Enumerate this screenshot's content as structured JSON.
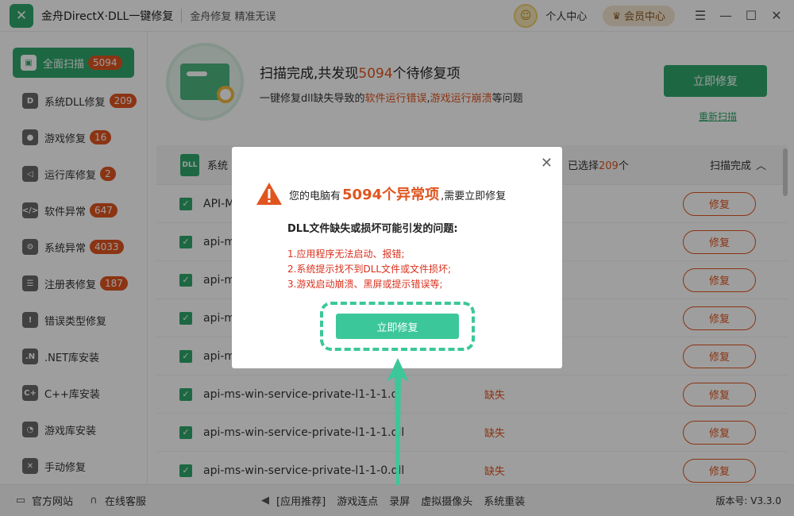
{
  "titlebar": {
    "app_title": "金舟DirectX·DLL一键修复",
    "slogan": "金舟修复 精准无误",
    "user_center": "个人中心",
    "vip_center": "会员中心"
  },
  "sidebar": {
    "items": [
      {
        "label": "全面扫描",
        "badge": "5094",
        "icon": "scan-icon"
      },
      {
        "label": "系统DLL修复",
        "badge": "209",
        "icon": "dll-icon"
      },
      {
        "label": "游戏修复",
        "badge": "16",
        "icon": "gamepad-icon"
      },
      {
        "label": "运行库修复",
        "badge": "2",
        "icon": "runtime-icon"
      },
      {
        "label": "软件异常",
        "badge": "647",
        "icon": "software-icon"
      },
      {
        "label": "系统异常",
        "badge": "4033",
        "icon": "gear-icon"
      },
      {
        "label": "注册表修复",
        "badge": "187",
        "icon": "registry-icon"
      },
      {
        "label": "错误类型修复",
        "badge": "",
        "icon": "warning-icon"
      },
      {
        "label": ".NET库安装",
        "badge": "",
        "icon": "dotnet-icon"
      },
      {
        "label": "C++库安装",
        "badge": "",
        "icon": "cpp-icon"
      },
      {
        "label": "游戏库安装",
        "badge": "",
        "icon": "pacman-icon"
      },
      {
        "label": "手动修复",
        "badge": "",
        "icon": "wrench-icon"
      }
    ]
  },
  "scan": {
    "title_prefix": "扫描完成,共发现",
    "title_count": "5094",
    "title_suffix": "个待修复项",
    "desc_prefix": "一键修复dll缺失导致的",
    "desc_warn1": "软件运行错误",
    "desc_sep": ",",
    "desc_warn2": "游戏运行崩溃",
    "desc_suffix": "等问题",
    "fix_now": "立即修复",
    "rescan": "重新扫描"
  },
  "list": {
    "header_name": "系统",
    "selected_prefix": "已选择",
    "selected_count": "209",
    "selected_suffix": "个",
    "status": "扫描完成",
    "rows": [
      {
        "name": "API-M",
        "status": "",
        "action": "修复"
      },
      {
        "name": "api-m",
        "status": "",
        "action": "修复"
      },
      {
        "name": "api-m",
        "status": "",
        "action": "修复"
      },
      {
        "name": "api-m",
        "status": "",
        "action": "修复"
      },
      {
        "name": "api-m",
        "status": "",
        "action": "修复"
      },
      {
        "name": "api-ms-win-service-private-l1-1-1.d",
        "status": "缺失",
        "action": "修复"
      },
      {
        "name": "api-ms-win-service-private-l1-1-1.dll",
        "status": "缺失",
        "action": "修复"
      },
      {
        "name": "api-ms-win-service-private-l1-1-0.dll",
        "status": "缺失",
        "action": "修复"
      }
    ]
  },
  "footer": {
    "official_site": "官方网站",
    "online_service": "在线客服",
    "app_recommend": "[应用推荐]",
    "links": [
      "游戏连点",
      "录屏",
      "虚拟摄像头",
      "系统重装"
    ],
    "version": "版本号: V3.3.0"
  },
  "modal": {
    "head_prefix": "您的电脑有",
    "head_count": "5094个异常项",
    "head_suffix": ",需要立即修复",
    "sub": "DLL文件缺失或损坏可能引发的问题:",
    "issues": [
      "1.应用程序无法启动、报错;",
      "2.系统提示找不到DLL文件或文件损坏;",
      "3.游戏启动崩溃、黑屏或提示错误等;"
    ],
    "fix_now": "立即修复"
  },
  "colors": {
    "accent_green": "#2fa86c",
    "modal_green": "#3cc79a",
    "warn_orange": "#e0551f",
    "issue_red": "#d9311e"
  }
}
